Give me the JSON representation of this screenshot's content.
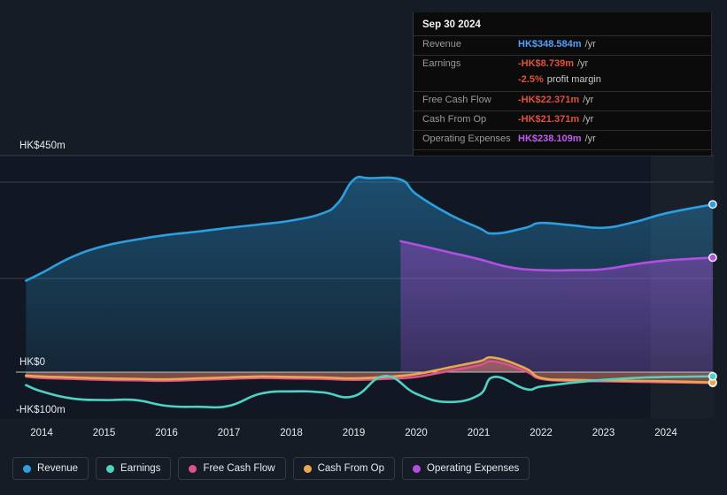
{
  "chart_data": {
    "type": "area",
    "title": "",
    "xlabel": "",
    "ylabel": "",
    "currency": "HK$",
    "ylim": [
      -100,
      450
    ],
    "xlim": [
      2013.7,
      2024.9
    ],
    "grid": true,
    "legend_position": "bottom-left",
    "axis": {
      "y_ticks": [
        {
          "value": 450,
          "label": "HK$450m"
        },
        {
          "value": 0,
          "label": "HK$0"
        },
        {
          "value": -100,
          "label": "-HK$100m"
        }
      ],
      "x_ticks": [
        "2014",
        "2015",
        "2016",
        "2017",
        "2018",
        "2019",
        "2020",
        "2021",
        "2022",
        "2023",
        "2024"
      ]
    },
    "forecast_start": 2024.0,
    "series": [
      {
        "name": "Revenue",
        "color": "#2b9fe0",
        "x": [
          2013.75,
          2014.0,
          2014.5,
          2015.0,
          2015.5,
          2016.0,
          2016.5,
          2017.0,
          2017.5,
          2018.0,
          2018.5,
          2018.75,
          2019.0,
          2019.25,
          2019.75,
          2020.0,
          2020.5,
          2021.0,
          2021.25,
          2021.75,
          2022.0,
          2022.5,
          2023.0,
          2023.5,
          2024.0,
          2024.75
        ],
        "values": [
          190,
          206,
          240,
          262,
          275,
          285,
          292,
          300,
          307,
          315,
          330,
          352,
          400,
          403,
          400,
          370,
          330,
          300,
          288,
          300,
          310,
          305,
          300,
          312,
          330,
          348.584
        ]
      },
      {
        "name": "Earnings",
        "color": "#4fd1c5",
        "x": [
          2013.75,
          2014.0,
          2014.5,
          2015.0,
          2015.5,
          2016.0,
          2016.5,
          2017.0,
          2017.5,
          2018.0,
          2018.5,
          2019.0,
          2019.5,
          2020.0,
          2020.5,
          2021.0,
          2021.25,
          2021.75,
          2022.0,
          2022.5,
          2023.0,
          2023.5,
          2024.0,
          2024.75
        ],
        "values": [
          -27,
          -40,
          -55,
          -58,
          -58,
          -70,
          -72,
          -70,
          -45,
          -40,
          -42,
          -50,
          -8,
          -45,
          -62,
          -48,
          -10,
          -35,
          -30,
          -22,
          -16,
          -12,
          -10,
          -8.739
        ]
      },
      {
        "name": "Free Cash Flow",
        "color": "#e0508a",
        "x": [
          2013.75,
          2014.0,
          2014.5,
          2015.0,
          2015.5,
          2016.0,
          2016.5,
          2017.0,
          2017.5,
          2018.0,
          2018.5,
          2019.0,
          2019.5,
          2020.0,
          2020.5,
          2021.0,
          2021.25,
          2021.75,
          2022.0,
          2022.5,
          2023.0,
          2023.5,
          2024.0,
          2024.75
        ],
        "values": [
          -9,
          -12,
          -14,
          -16,
          -17,
          -18,
          -16,
          -14,
          -12,
          -13,
          -14,
          -16,
          -14,
          -10,
          2,
          14,
          22,
          2,
          -14,
          -18,
          -19,
          -20,
          -21,
          -22.371
        ]
      },
      {
        "name": "Cash From Op",
        "color": "#e8a84f",
        "x": [
          2013.75,
          2014.0,
          2014.5,
          2015.0,
          2015.5,
          2016.0,
          2016.5,
          2017.0,
          2017.5,
          2018.0,
          2018.5,
          2019.0,
          2019.5,
          2020.0,
          2020.5,
          2021.0,
          2021.25,
          2021.75,
          2022.0,
          2022.5,
          2023.0,
          2023.5,
          2024.0,
          2024.75
        ],
        "values": [
          -7,
          -9,
          -11,
          -13,
          -14,
          -15,
          -13,
          -11,
          -9,
          -10,
          -11,
          -13,
          -10,
          -4,
          9,
          22,
          30,
          8,
          -12,
          -16,
          -17,
          -18,
          -19,
          -21.371
        ]
      },
      {
        "name": "Operating Expenses",
        "color": "#b24fe0",
        "x": [
          2019.75,
          2020.0,
          2020.5,
          2021.0,
          2021.5,
          2022.0,
          2022.5,
          2023.0,
          2023.5,
          2024.0,
          2024.75
        ],
        "values": [
          272,
          265,
          250,
          235,
          218,
          212,
          212,
          214,
          224,
          232,
          238.109
        ]
      }
    ]
  },
  "tooltip": {
    "title": "Sep 30 2024",
    "unit": "/yr",
    "rows": [
      {
        "label": "Revenue",
        "value": "HK$348.584m",
        "color": "#4da3ff",
        "unit": "/yr"
      },
      {
        "label": "Earnings",
        "value": "-HK$8.739m",
        "color": "#e2503f",
        "unit": "/yr"
      },
      {
        "label": "Free Cash Flow",
        "value": "-HK$22.371m",
        "color": "#e2503f",
        "unit": "/yr"
      },
      {
        "label": "Cash From Op",
        "value": "-HK$21.371m",
        "color": "#e2503f",
        "unit": "/yr"
      },
      {
        "label": "Operating Expenses",
        "value": "HK$238.109m",
        "color": "#c05cf0",
        "unit": "/yr"
      }
    ],
    "margin": {
      "value": "-2.5%",
      "text": "profit margin",
      "color": "#e2503f"
    }
  },
  "legend": {
    "items": [
      {
        "label": "Revenue",
        "color": "#2b9fe0"
      },
      {
        "label": "Earnings",
        "color": "#4fd1c5"
      },
      {
        "label": "Free Cash Flow",
        "color": "#e0508a"
      },
      {
        "label": "Cash From Op",
        "color": "#e8a84f"
      },
      {
        "label": "Operating Expenses",
        "color": "#b24fe0"
      }
    ]
  }
}
